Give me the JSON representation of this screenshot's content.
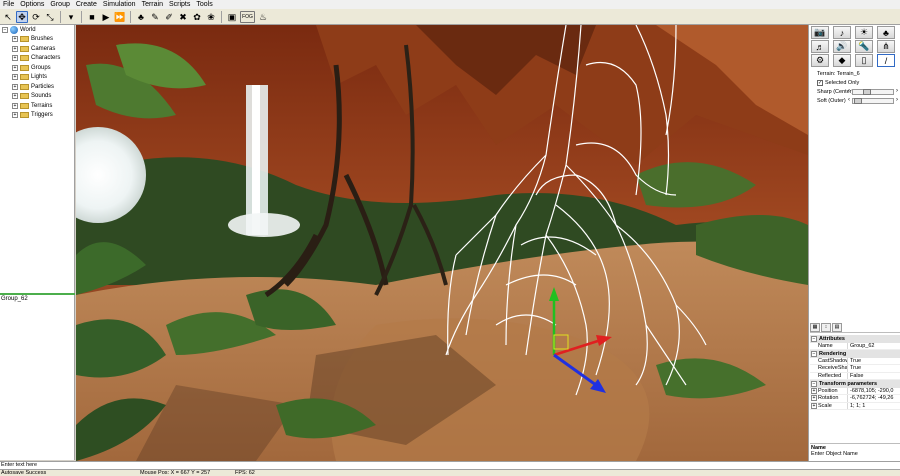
{
  "menu": [
    "File",
    "Options",
    "Group",
    "Create",
    "Simulation",
    "Terrain",
    "Scripts",
    "Tools"
  ],
  "toolbar": {
    "buttons": [
      {
        "name": "select-arrow-icon",
        "glyph": "↖"
      },
      {
        "name": "move-icon",
        "glyph": "✥"
      },
      {
        "name": "rotate-icon",
        "glyph": "⟳"
      },
      {
        "name": "scale-icon",
        "glyph": "⤡"
      },
      {
        "name": "mode-dropdown",
        "glyph": "▾"
      },
      {
        "name": "stop-icon",
        "glyph": "■"
      },
      {
        "name": "play-icon",
        "glyph": "▶"
      },
      {
        "name": "fast-forward-icon",
        "glyph": "⏩"
      },
      {
        "name": "add-tree-icon",
        "glyph": "♣"
      },
      {
        "name": "paint-icon",
        "glyph": "✎"
      },
      {
        "name": "edit-icon",
        "glyph": "✐"
      },
      {
        "name": "eraser-icon",
        "glyph": "✖"
      },
      {
        "name": "grass-icon",
        "glyph": "✿"
      },
      {
        "name": "plant-icon",
        "glyph": "❀"
      },
      {
        "name": "window-icon",
        "glyph": "▣"
      },
      {
        "name": "fog-icon",
        "glyph": "FOG"
      },
      {
        "name": "fire-icon",
        "glyph": "♨"
      }
    ]
  },
  "tree": {
    "root": "World",
    "items": [
      "Brushes",
      "Cameras",
      "Characters",
      "Groups",
      "Lights",
      "Particles",
      "Sounds",
      "Terrains",
      "Triggers"
    ]
  },
  "selection": {
    "name": "Group_62"
  },
  "right_panel": {
    "icons": [
      {
        "name": "camera-icon",
        "glyph": "📷"
      },
      {
        "name": "music-icon",
        "glyph": "♪"
      },
      {
        "name": "sun-icon",
        "glyph": "☀"
      },
      {
        "name": "tree-icon",
        "glyph": "♣"
      },
      {
        "name": "guitar-icon",
        "glyph": "♬"
      },
      {
        "name": "speaker-icon",
        "glyph": "🔊"
      },
      {
        "name": "flashlight-icon",
        "glyph": "🔦"
      },
      {
        "name": "grass-icon",
        "glyph": "⋔"
      },
      {
        "name": "gear-icon",
        "glyph": "⚙"
      },
      {
        "name": "terrain-icon",
        "glyph": "◆"
      },
      {
        "name": "phone-icon",
        "glyph": "▯"
      },
      {
        "name": "brush-icon",
        "glyph": "/"
      }
    ],
    "terrain_label": "Terrain: Terrain_6",
    "selected_only": "Selected Only",
    "sharp_label": "Sharp (Center)",
    "soft_label": "Soft (Outer)",
    "sharp_level": 0.28,
    "soft_level": 0.04
  },
  "properties": {
    "categories": [
      {
        "title": "Attributes",
        "rows": [
          {
            "k": "Name",
            "v": "Group_62"
          }
        ]
      },
      {
        "title": "Rendering",
        "rows": [
          {
            "k": "CastShadow",
            "v": "True"
          },
          {
            "k": "ReceiveShado",
            "v": "True"
          },
          {
            "k": "Reflected",
            "v": "False"
          }
        ]
      },
      {
        "title": "Transform parameters",
        "rows": [
          {
            "k": "Position",
            "v": "-6878,105; -290,0"
          },
          {
            "k": "Rotation",
            "v": "-6,762724; -49,26"
          },
          {
            "k": "Scale",
            "v": "1; 1; 1"
          }
        ]
      }
    ],
    "desc_title": "Name",
    "desc_text": "Enter Object Name"
  },
  "command": {
    "placeholder": "Enter text here"
  },
  "status": {
    "message": "Autosave Success",
    "mouse": "Mouse Pos: X = 667  Y = 257",
    "fps": "FPS: 62"
  },
  "colors": {
    "accent": "#316ac5",
    "divider_green": "#4cae4c",
    "gizmo_x": "#e02020",
    "gizmo_y": "#20c020",
    "gizmo_z": "#2030e0"
  }
}
